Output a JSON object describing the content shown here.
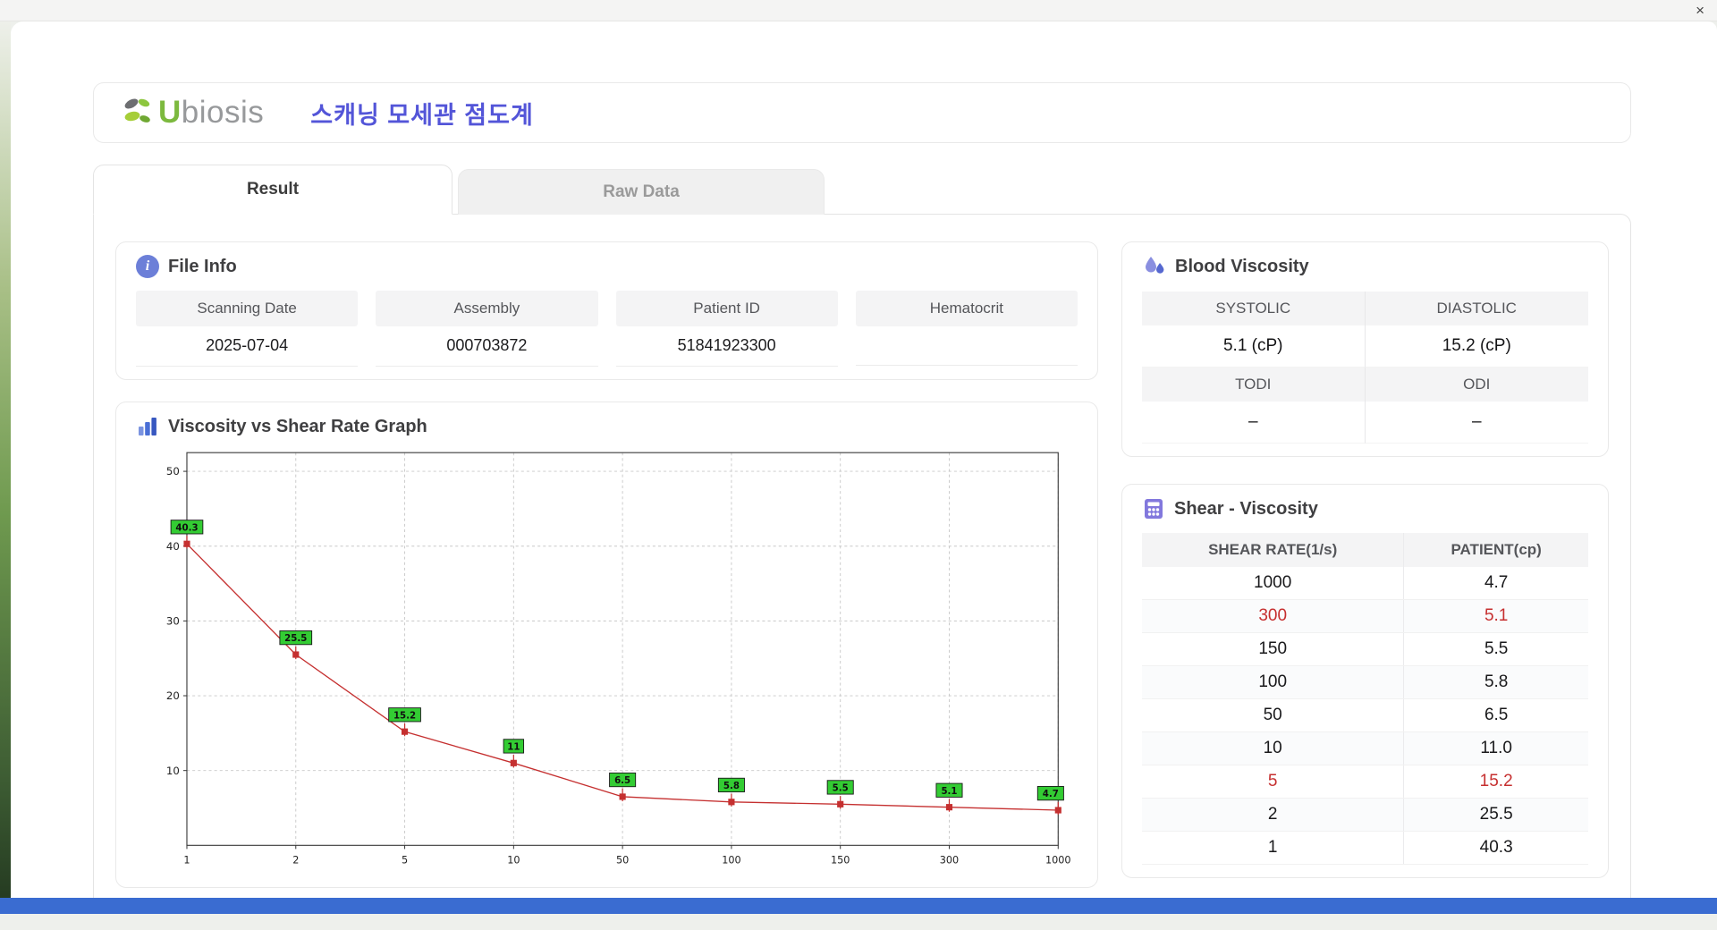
{
  "window": {
    "close_label": "×"
  },
  "header": {
    "logo_u": "U",
    "logo_rest": "biosis",
    "title": "스캐닝 모세관 점도계"
  },
  "tabs": [
    {
      "label": "Result",
      "active": true
    },
    {
      "label": "Raw Data",
      "active": false
    }
  ],
  "file_info": {
    "title": "File Info",
    "fields": [
      {
        "label": "Scanning Date",
        "value": "2025-07-04"
      },
      {
        "label": "Assembly",
        "value": "000703872"
      },
      {
        "label": "Patient ID",
        "value": "51841923300"
      },
      {
        "label": "Hematocrit",
        "value": ""
      }
    ]
  },
  "blood_viscosity": {
    "title": "Blood Viscosity",
    "row1": {
      "headers": [
        "SYSTOLIC",
        "DIASTOLIC"
      ],
      "values": [
        "5.1 (cP)",
        "15.2 (cP)"
      ]
    },
    "row2": {
      "headers": [
        "TODI",
        "ODI"
      ],
      "values": [
        "–",
        "–"
      ]
    }
  },
  "graph": {
    "title": "Viscosity vs Shear Rate Graph"
  },
  "chart_data": {
    "type": "line",
    "title": "Viscosity vs Shear Rate Graph",
    "x": [
      1,
      2,
      5,
      10,
      50,
      100,
      150,
      300,
      1000
    ],
    "x_scale": "categorical-even-spacing",
    "values": [
      40.3,
      25.5,
      15.2,
      11,
      6.5,
      5.8,
      5.5,
      5.1,
      4.7
    ],
    "labels": [
      "40.3",
      "25.5",
      "15.2",
      "11",
      "6.5",
      "5.8",
      "5.5",
      "5.1",
      "4.7"
    ],
    "xlabel": "",
    "ylabel": "",
    "ylim": [
      0,
      52.5
    ],
    "yticks": [
      10,
      20,
      30,
      40,
      50
    ],
    "grid": true,
    "line_color": "#c53030",
    "label_bg": "#33cc33"
  },
  "shear_table": {
    "title": "Shear - Viscosity",
    "columns": [
      "SHEAR RATE(1/s)",
      "PATIENT(cp)"
    ],
    "rows": [
      {
        "shear": "1000",
        "patient": "4.7",
        "highlight": false
      },
      {
        "shear": "300",
        "patient": "5.1",
        "highlight": true
      },
      {
        "shear": "150",
        "patient": "5.5",
        "highlight": false
      },
      {
        "shear": "100",
        "patient": "5.8",
        "highlight": false
      },
      {
        "shear": "50",
        "patient": "6.5",
        "highlight": false
      },
      {
        "shear": "10",
        "patient": "11.0",
        "highlight": false
      },
      {
        "shear": "5",
        "patient": "15.2",
        "highlight": true
      },
      {
        "shear": "2",
        "patient": "25.5",
        "highlight": false
      },
      {
        "shear": "1",
        "patient": "40.3",
        "highlight": false
      }
    ]
  },
  "colors": {
    "accent": "#5355d8",
    "highlight_red": "#c62f2f",
    "label_green": "#33cc33"
  }
}
